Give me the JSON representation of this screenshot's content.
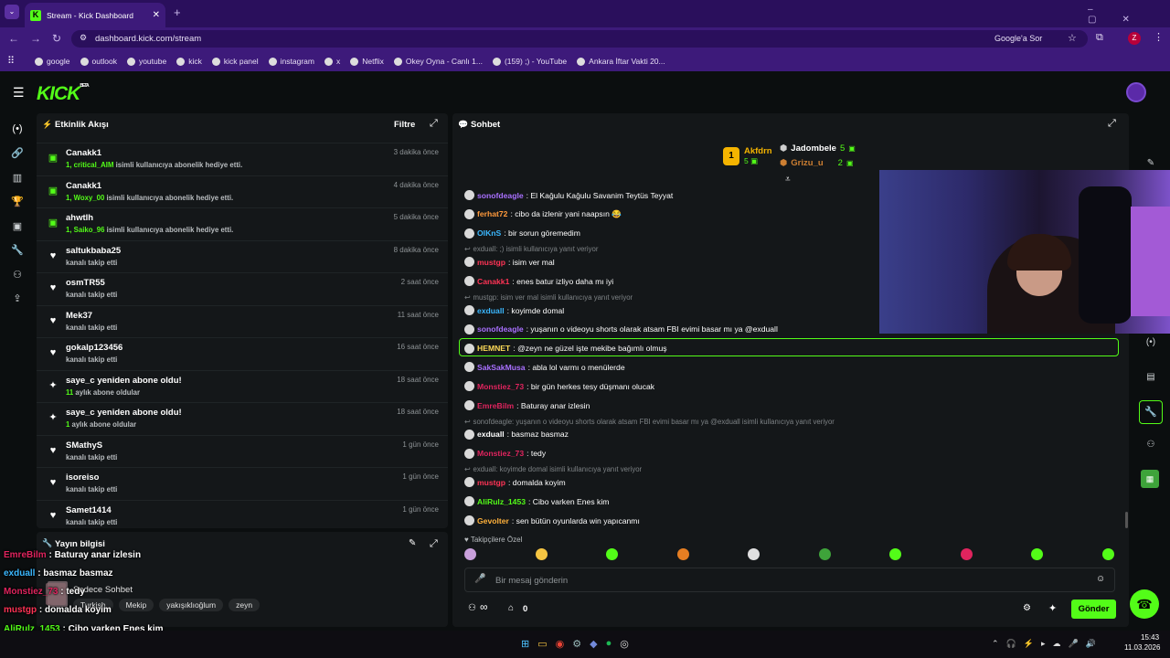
{
  "browser": {
    "tab_title": "Stream - Kick Dashboard",
    "url": "dashboard.kick.com/stream",
    "google_sor": "Google'a Sor",
    "profile_initial": "Z",
    "bookmarks": [
      "google",
      "outlook",
      "youtube",
      "kick",
      "kick panel",
      "instagram",
      "x",
      "Netflix",
      "Okey Oyna - Canlı 1...",
      "(159) ;) - YouTube",
      "Ankara İftar Vakti 20..."
    ]
  },
  "app": {
    "logo": "KICK",
    "logo_beta": "BETA"
  },
  "activity": {
    "title": "Etkinlik Akışı",
    "filter": "Filtre",
    "items": [
      {
        "name": "Canakk1",
        "hl": "1, critical_AIM",
        "sub": " isimli kullanıcıya abonelik hediye etti.",
        "time": "3 dakika önce",
        "icon": "gift-icon"
      },
      {
        "name": "Canakk1",
        "hl": "1, Woxy_00",
        "sub": " isimli kullanıcıya abonelik hediye etti.",
        "time": "4 dakika önce",
        "icon": "gift-icon"
      },
      {
        "name": "ahwtlh",
        "hl": "1, Saiko_96",
        "sub": " isimli kullanıcıya abonelik hediye etti.",
        "time": "5 dakika önce",
        "icon": "gift-icon"
      },
      {
        "name": "saltukbaba25",
        "hl": "",
        "sub": "kanalı takip etti",
        "time": "8 dakika önce",
        "icon": "heart-icon"
      },
      {
        "name": "osmTR55",
        "hl": "",
        "sub": "kanalı takip etti",
        "time": "2 saat önce",
        "icon": "heart-icon"
      },
      {
        "name": "Mek37",
        "hl": "",
        "sub": "kanalı takip etti",
        "time": "11 saat önce",
        "icon": "heart-icon"
      },
      {
        "name": "gokalp123456",
        "hl": "",
        "sub": "kanalı takip etti",
        "time": "16 saat önce",
        "icon": "heart-icon"
      },
      {
        "name": "saye_c yeniden abone oldu!",
        "hl": "11",
        "sub": " aylık abone oldular",
        "time": "18 saat önce",
        "icon": "sparkle-icon"
      },
      {
        "name": "saye_c yeniden abone oldu!",
        "hl": "1",
        "sub": " aylık abone oldular",
        "time": "18 saat önce",
        "icon": "sparkle-icon"
      },
      {
        "name": "SMathyS",
        "hl": "",
        "sub": "kanalı takip etti",
        "time": "1 gün önce",
        "icon": "heart-icon"
      },
      {
        "name": "isoreiso",
        "hl": "",
        "sub": "kanalı takip etti",
        "time": "1 gün önce",
        "icon": "heart-icon"
      },
      {
        "name": "Samet1414",
        "hl": "",
        "sub": "kanalı takip etti",
        "time": "1 gün önce",
        "icon": "heart-icon"
      }
    ]
  },
  "stream_info": {
    "title": "Yayın bilgisi",
    "chat_label": "Sadece Sohbet",
    "tags": [
      "Turkish",
      "Mekip",
      "yakışıklıoğlum",
      "zeyn"
    ]
  },
  "chat": {
    "title": "Sohbet",
    "top": {
      "first": "Akfdrn",
      "first_count": "5",
      "second": "Jadombele",
      "second_count": "5",
      "third": "Grizu_u",
      "third_count": "2"
    },
    "messages": [
      {
        "user": "sonofdeagle",
        "color": "#a970ff",
        "text": ": El Kağulu Kağulu Savanim Teytüs Teyyat",
        "reply": ""
      },
      {
        "user": "ferhat72",
        "color": "#ff9a3c",
        "text": ": cibo da izlenir yani naapsın 😂",
        "reply": ""
      },
      {
        "user": "OlKnS",
        "color": "#3bb8ff",
        "text": ": bir sorun göremedim",
        "reply": ""
      },
      {
        "user": "mustgp",
        "color": "#ff3355",
        "text": ": isim ver mal",
        "reply": "exduall: ;) isimli kullanıcıya yanıt veriyor"
      },
      {
        "user": "Canakk1",
        "color": "#ff3355",
        "text": ": enes batur izliyo daha mı iyi",
        "reply": ""
      },
      {
        "user": "exduall",
        "color": "#3bb8ff",
        "text": ": koyimde domal",
        "reply": "mustgp: isim ver mal isimli kullanıcıya yanıt veriyor"
      },
      {
        "user": "sonofdeagle",
        "color": "#a970ff",
        "text": ": yuşanın o videoyu shorts olarak atsam FBI evimi basar mı ya @exduall",
        "reply": ""
      },
      {
        "user": "HEMNET",
        "color": "#ffdb58",
        "text": ": @zeyn ne güzel işte mekibe bağımlı olmuş",
        "reply": ""
      },
      {
        "user": "SakSakMusa",
        "color": "#a970ff",
        "text": ": abla lol varmı o menülerde",
        "reply": ""
      },
      {
        "user": "Monstiez_73",
        "color": "#e0245e",
        "text": ": bir gün herkes tesy düşmanı olucak",
        "reply": ""
      },
      {
        "user": "EmreBilm",
        "color": "#e0245e",
        "text": ": Baturay anar izlesin",
        "reply": ""
      },
      {
        "user": "exduall",
        "color": "#ffffff",
        "text": ": basmaz basmaz",
        "reply": "sonofdeagle: yuşanın o videoyu shorts olarak atsam FBI evimi basar mı ya @exduall isimli kullanıcıya yanıt veriyor"
      },
      {
        "user": "Monstiez_73",
        "color": "#e0245e",
        "text": ": tedy",
        "reply": ""
      },
      {
        "user": "mustgp",
        "color": "#ff3355",
        "text": ": domalda koyim",
        "reply": "exduall: koyimde domal isimli kullanıcıya yanıt veriyor"
      },
      {
        "user": "AliRulz_1453",
        "color": "#53fc18",
        "text": ": Cibo varken Enes kim",
        "reply": ""
      },
      {
        "user": "Gevolter",
        "color": "#ffb13b",
        "text": ": sen bütün oyunlarda win yapıcanmı",
        "reply": ""
      }
    ],
    "followers_only": "Takipçilere Özel",
    "input_placeholder": "Bir mesaj gönderin",
    "send": "Gönder",
    "infinity": "∞",
    "points": "0"
  },
  "overlay": [
    {
      "user": "EmreBilm",
      "color": "#e0245e",
      "text": " : Baturay anar izlesin"
    },
    {
      "user": "exduall",
      "color": "#3bb8ff",
      "text": " : basmaz basmaz"
    },
    {
      "user": "Monstiez_73",
      "color": "#e0245e",
      "text": " : tedy"
    },
    {
      "user": "mustgp",
      "color": "#ff3355",
      "text": " : domalda koyim"
    },
    {
      "user": "AliRulz_1453",
      "color": "#53fc18",
      "text": " : Cibo varken Enes kim"
    },
    {
      "user": "Gevolter",
      "color": "#ffb13b",
      "text": " : sen bütün oyunlarda win yapıcanmı"
    }
  ],
  "taskbar": {
    "time": "15:43",
    "date": "11.03.2026"
  }
}
